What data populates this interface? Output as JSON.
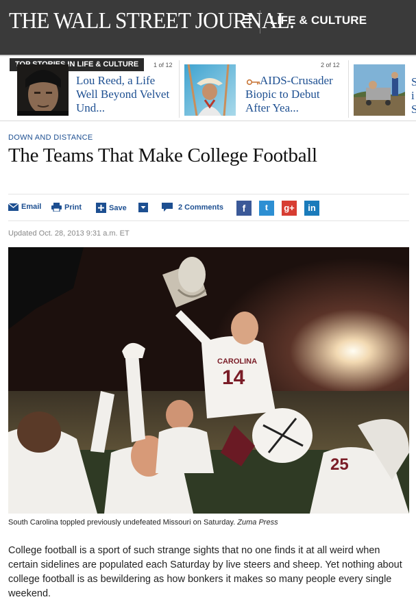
{
  "header": {
    "masthead": "THE WALL STREET JOURNAL.",
    "section": "LIFE & CULTURE",
    "menu_icon": "menu-icon"
  },
  "top_stories": {
    "label": "TOP STORIES IN LIFE & CULTURE",
    "cards": [
      {
        "pager": "1 of 12",
        "headline_lines": [
          "Lou Reed, a Life",
          "Well Beyond Velvet",
          "Und..."
        ]
      },
      {
        "pager": "2 of 12",
        "headline_lines": [
          "AIDS-Crusader",
          "Biopic to Debut",
          "After Yea..."
        ]
      },
      {
        "pager": "",
        "headline_lines": []
      }
    ]
  },
  "article": {
    "kicker": "DOWN AND DISTANCE",
    "title": "The Teams That Make College Football",
    "tools": {
      "email": "Email",
      "print": "Print",
      "save": "Save",
      "comments": "2 Comments"
    },
    "social": {
      "facebook": "f",
      "twitter": "t",
      "googleplus": "g+",
      "linkedin": "in"
    },
    "updated": "Updated Oct. 28, 2013 9:31 a.m. ET",
    "photo_jersey": "14",
    "photo_jersey_text": "CAROLINA",
    "caption_text": "South Carolina toppled previously undefeated Missouri on Saturday.",
    "caption_credit": "Zuma Press",
    "body_lines": [
      "College football is a sport of such strange sights that no one finds it at all weird when",
      "certain sidelines are populated each Saturday by live steers and sheep. Yet nothing about",
      "college football is as bewildering as how bonkers it makes so many people every single",
      "weekend."
    ]
  },
  "colors": {
    "header_bg": "#3a3a3a",
    "link_blue": "#1d4f91",
    "facebook": "#3b5998",
    "twitter": "#2d8fd3",
    "googleplus": "#d73d32",
    "linkedin": "#1a7bbb"
  }
}
